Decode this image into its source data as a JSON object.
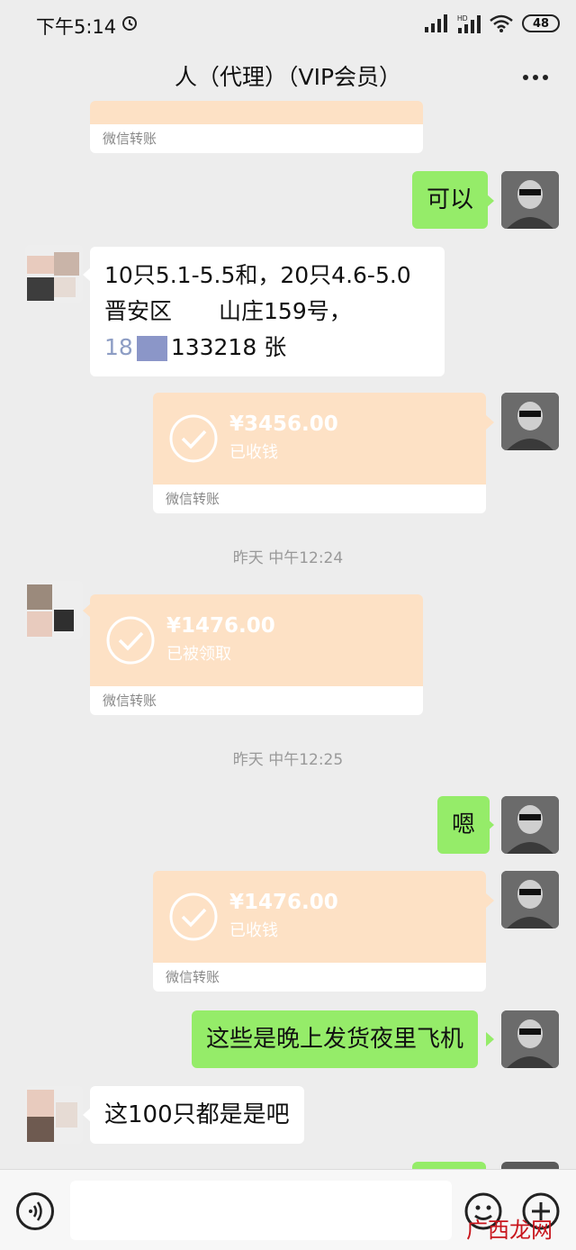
{
  "status_bar": {
    "time": "下午5:14",
    "battery": "48"
  },
  "header": {
    "title": "人（代理）（VIP会员）"
  },
  "messages": {
    "partial_transfer_label": "微信转账",
    "m1_text": "可以",
    "m2_line1": "10只5.1-5.5和，20只4.6-5.0",
    "m2_line2": "晋安区",
    "m2_line2b": "山庄159号，",
    "m2_line3a": "18",
    "m2_line3b": "133218 张",
    "t1_amount": "¥3456.00",
    "t1_status": "已收钱",
    "t1_label": "微信转账",
    "ts1": "昨天 中午12:24",
    "t2_amount": "¥1476.00",
    "t2_status": "已被领取",
    "t2_label": "微信转账",
    "ts2": "昨天 中午12:25",
    "m3_text": "嗯",
    "t3_amount": "¥1476.00",
    "t3_status": "已收钱",
    "t3_label": "微信转账",
    "m4_text": "这些是晚上发货夜里飞机",
    "m5_text": "这100只都是是吧"
  },
  "input": {
    "placeholder": ""
  },
  "watermark": "广西龙网",
  "colors": {
    "my_bubble": "#95ec69",
    "transfer_card": "#fde1c5",
    "background": "#ededed"
  }
}
